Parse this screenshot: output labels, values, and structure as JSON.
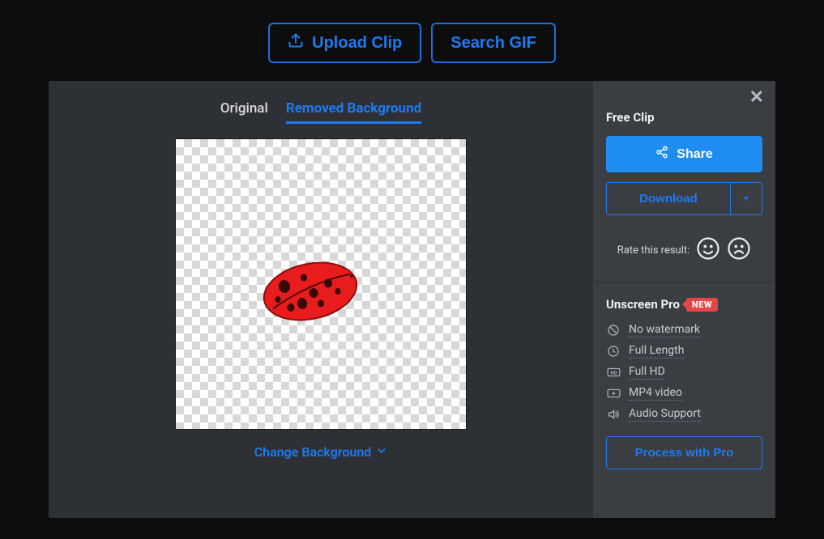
{
  "top": {
    "upload_label": "Upload Clip",
    "search_gif_label": "Search GIF"
  },
  "tabs": {
    "original": "Original",
    "removed": "Removed Background"
  },
  "change_bg_label": "Change Background",
  "close_icon_glyph": "✕",
  "free": {
    "title": "Free Clip",
    "share_label": "Share",
    "download_label": "Download",
    "rate_label": "Rate this result:"
  },
  "pro": {
    "title": "Unscreen Pro",
    "badge": "NEW",
    "features": [
      {
        "icon": "no-watermark-icon",
        "label": "No watermark"
      },
      {
        "icon": "full-length-icon",
        "label": "Full Length"
      },
      {
        "icon": "full-hd-icon",
        "label": "Full HD"
      },
      {
        "icon": "mp4-icon",
        "label": "MP4 video"
      },
      {
        "icon": "audio-icon",
        "label": "Audio Support"
      }
    ],
    "process_label": "Process with Pro"
  }
}
